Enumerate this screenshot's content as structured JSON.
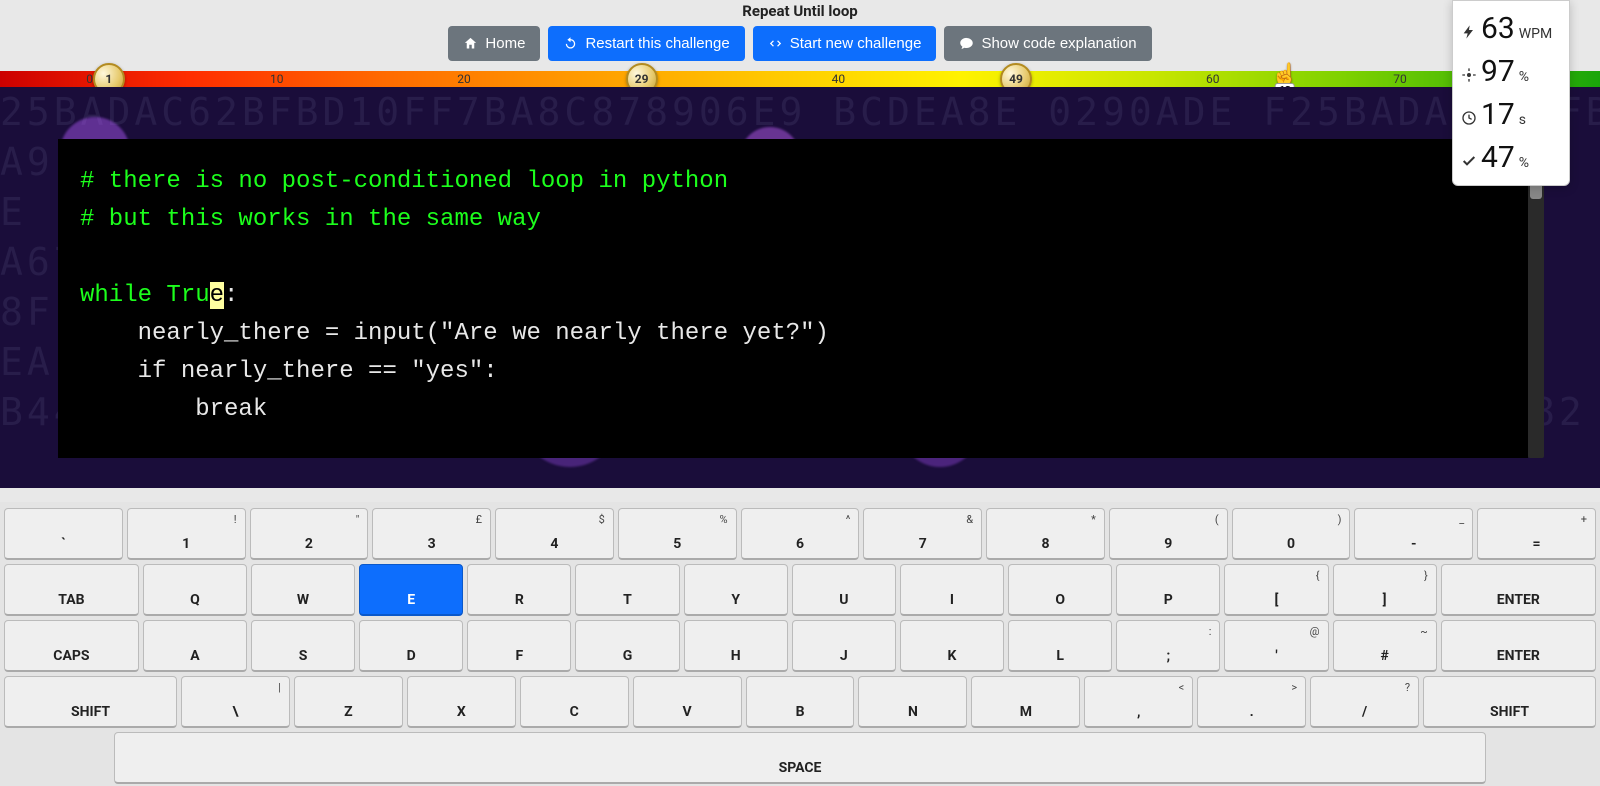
{
  "title": "Repeat Until loop",
  "buttons": {
    "home": "Home",
    "restart": "Restart this challenge",
    "start_new": "Start new challenge",
    "explain": "Show code explanation"
  },
  "gradient": {
    "ticks": [
      0,
      10,
      20,
      30,
      40,
      50,
      60,
      70
    ],
    "tick_spacing_pct": 11.7,
    "medals": [
      {
        "value": "1",
        "pos_pct": 6.8
      },
      {
        "value": "29",
        "pos_pct": 40.1
      },
      {
        "value": "49",
        "pos_pct": 63.5
      }
    ],
    "cursor": {
      "value": "63",
      "pos_pct": 80.3
    }
  },
  "stats": {
    "wpm": "63",
    "wpm_unit": "WPM",
    "accuracy": "97",
    "acc_unit": "%",
    "time": "17",
    "time_unit": "s",
    "chars": "47",
    "chars_unit": "%"
  },
  "code": {
    "typed": "# there is no post-conditioned loop in python\n# but this works in the same way\n\nwhile Tru",
    "cursor": "e",
    "untyped": ":\n    nearly_there = input(\"Are we nearly there yet?\")\n    if nearly_there == \"yes\":\n        break"
  },
  "keyboard": {
    "row1": [
      {
        "m": "`",
        "u": ""
      },
      {
        "m": "1",
        "u": "!"
      },
      {
        "m": "2",
        "u": "\""
      },
      {
        "m": "3",
        "u": "£"
      },
      {
        "m": "4",
        "u": "$"
      },
      {
        "m": "5",
        "u": "%"
      },
      {
        "m": "6",
        "u": "^"
      },
      {
        "m": "7",
        "u": "&"
      },
      {
        "m": "8",
        "u": "*"
      },
      {
        "m": "9",
        "u": "("
      },
      {
        "m": "0",
        "u": ")"
      },
      {
        "m": "-",
        "u": "_"
      },
      {
        "m": "=",
        "u": "+"
      }
    ],
    "row2": [
      {
        "m": "TAB",
        "w": "wide1"
      },
      {
        "m": "Q"
      },
      {
        "m": "W"
      },
      {
        "m": "E",
        "active": true
      },
      {
        "m": "R"
      },
      {
        "m": "T"
      },
      {
        "m": "Y"
      },
      {
        "m": "U"
      },
      {
        "m": "I"
      },
      {
        "m": "O"
      },
      {
        "m": "P"
      },
      {
        "m": "[",
        "u": "{"
      },
      {
        "m": "]",
        "u": "}"
      },
      {
        "m": "ENTER",
        "w": "wideEnter"
      }
    ],
    "row3": [
      {
        "m": "CAPS",
        "w": "wide1"
      },
      {
        "m": "A"
      },
      {
        "m": "S"
      },
      {
        "m": "D"
      },
      {
        "m": "F"
      },
      {
        "m": "G"
      },
      {
        "m": "H"
      },
      {
        "m": "J"
      },
      {
        "m": "K"
      },
      {
        "m": "L"
      },
      {
        "m": ";",
        "u": ":"
      },
      {
        "m": "'",
        "u": "@"
      },
      {
        "m": "#",
        "u": "~"
      },
      {
        "m": "ENTER",
        "w": "wideEnter"
      }
    ],
    "row4": [
      {
        "m": "SHIFT",
        "w": "wide2"
      },
      {
        "m": "\\",
        "u": "|"
      },
      {
        "m": "Z"
      },
      {
        "m": "X"
      },
      {
        "m": "C"
      },
      {
        "m": "V"
      },
      {
        "m": "B"
      },
      {
        "m": "N"
      },
      {
        "m": "M"
      },
      {
        "m": ",",
        "u": "<"
      },
      {
        "m": ".",
        "u": ">"
      },
      {
        "m": "/",
        "u": "?"
      },
      {
        "m": "SHIFT",
        "w": "wide2"
      }
    ],
    "space": "SPACE"
  }
}
